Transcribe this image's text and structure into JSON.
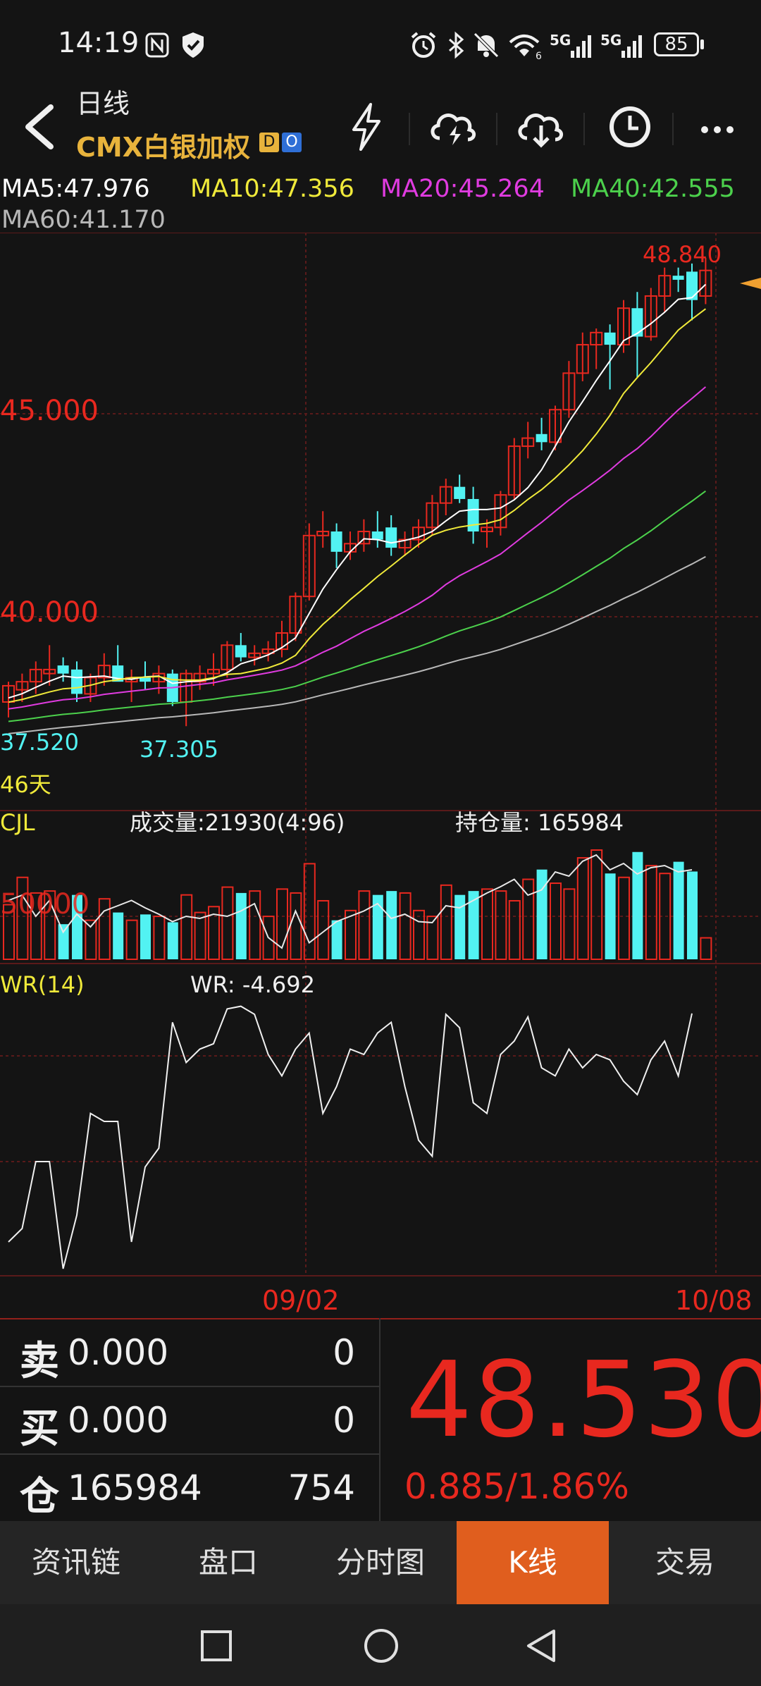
{
  "status_bar": {
    "time": "14:19",
    "icons": [
      "nfc-icon",
      "shield-check-icon",
      "alarm-icon",
      "bluetooth-icon",
      "mute-icon",
      "wifi-6-icon",
      "signal-5g-icon",
      "signal-5g-icon"
    ],
    "battery": "85"
  },
  "header": {
    "title": "日线",
    "subtitle": "CMX白银加权",
    "tag_d": "D",
    "tag_o": "O",
    "buttons": [
      "flash-icon",
      "cloud-upload-icon",
      "cloud-download-icon",
      "clock-icon",
      "more-icon"
    ]
  },
  "ma_legend": {
    "ma5": "MA5:47.976",
    "ma10": "MA10:47.356",
    "ma20": "MA20:45.264",
    "ma40": "MA40:42.555",
    "ma60": "MA60:41.170",
    "colors": {
      "ma5": "#ffffff",
      "ma10": "#f0ea3a",
      "ma20": "#e03be0",
      "ma40": "#4cd14c",
      "ma60": "#b8b8b8"
    }
  },
  "price_axis": {
    "label_45": "45.000",
    "label_40": "40.000",
    "high_label": "48.840",
    "low_label_1": "37.520",
    "low_label_2": "37.305",
    "days": "46天"
  },
  "volume_panel": {
    "name": "CJL",
    "volume": "成交量:21930(4:96)",
    "open_interest": "持仓量: 165984",
    "axis_label": "50000"
  },
  "wr_panel": {
    "name": "WR(14)",
    "value": "WR: -4.692"
  },
  "dates": {
    "start": "09/02",
    "end": "10/08"
  },
  "quote": {
    "sell_label": "卖",
    "sell_price": "0.000",
    "sell_volume": "0",
    "buy_label": "买",
    "buy_price": "0.000",
    "buy_volume": "0",
    "oi_label": "仓",
    "oi_value": "165984",
    "oi_change": "754",
    "last_price": "48.530",
    "change": "0.885/1.86%"
  },
  "tabs": [
    {
      "label": "资讯链",
      "active": false
    },
    {
      "label": "盘口",
      "active": false
    },
    {
      "label": "分时图",
      "active": false
    },
    {
      "label": "K线",
      "active": true
    },
    {
      "label": "交易",
      "active": false
    }
  ],
  "colors": {
    "up": "#e8281f",
    "down": "#52f2f2",
    "accent": "#e05e1e"
  },
  "chart_data": {
    "type": "candlestick",
    "instrument": "CMX白银加权",
    "period": "日线",
    "candles": [
      {
        "o": 37.9,
        "h": 38.4,
        "l": 37.52,
        "c": 38.3
      },
      {
        "o": 38.2,
        "h": 38.6,
        "l": 37.9,
        "c": 38.4
      },
      {
        "o": 38.4,
        "h": 38.9,
        "l": 38.1,
        "c": 38.7
      },
      {
        "o": 38.6,
        "h": 39.3,
        "l": 38.3,
        "c": 38.7
      },
      {
        "o": 38.8,
        "h": 39.0,
        "l": 38.4,
        "c": 38.6
      },
      {
        "o": 38.7,
        "h": 38.9,
        "l": 37.9,
        "c": 38.1
      },
      {
        "o": 38.1,
        "h": 38.6,
        "l": 37.9,
        "c": 38.5
      },
      {
        "o": 38.5,
        "h": 39.1,
        "l": 38.3,
        "c": 38.8
      },
      {
        "o": 38.8,
        "h": 39.3,
        "l": 38.5,
        "c": 38.4
      },
      {
        "o": 38.4,
        "h": 38.7,
        "l": 37.9,
        "c": 38.5
      },
      {
        "o": 38.5,
        "h": 38.9,
        "l": 38.2,
        "c": 38.4
      },
      {
        "o": 38.4,
        "h": 38.8,
        "l": 38.1,
        "c": 38.6
      },
      {
        "o": 38.6,
        "h": 38.7,
        "l": 37.8,
        "c": 37.9
      },
      {
        "o": 37.9,
        "h": 38.7,
        "l": 37.305,
        "c": 38.6
      },
      {
        "o": 38.4,
        "h": 38.8,
        "l": 38.2,
        "c": 38.6
      },
      {
        "o": 38.6,
        "h": 39.1,
        "l": 38.3,
        "c": 38.7
      },
      {
        "o": 38.7,
        "h": 39.4,
        "l": 38.5,
        "c": 39.3
      },
      {
        "o": 39.3,
        "h": 39.6,
        "l": 38.9,
        "c": 39.0
      },
      {
        "o": 39.0,
        "h": 39.3,
        "l": 38.8,
        "c": 39.1
      },
      {
        "o": 39.1,
        "h": 39.4,
        "l": 38.9,
        "c": 39.2
      },
      {
        "o": 39.2,
        "h": 39.9,
        "l": 39.0,
        "c": 39.6
      },
      {
        "o": 39.6,
        "h": 40.6,
        "l": 39.4,
        "c": 40.5
      },
      {
        "o": 40.5,
        "h": 42.3,
        "l": 40.4,
        "c": 42.0
      },
      {
        "o": 42.0,
        "h": 42.6,
        "l": 41.7,
        "c": 42.1
      },
      {
        "o": 42.1,
        "h": 42.3,
        "l": 41.2,
        "c": 41.6
      },
      {
        "o": 41.6,
        "h": 42.1,
        "l": 41.4,
        "c": 41.8
      },
      {
        "o": 41.8,
        "h": 42.4,
        "l": 41.6,
        "c": 42.1
      },
      {
        "o": 42.1,
        "h": 42.6,
        "l": 41.7,
        "c": 41.9
      },
      {
        "o": 42.2,
        "h": 42.5,
        "l": 41.5,
        "c": 41.7
      },
      {
        "o": 41.7,
        "h": 42.1,
        "l": 41.5,
        "c": 41.9
      },
      {
        "o": 41.9,
        "h": 42.4,
        "l": 41.7,
        "c": 42.2
      },
      {
        "o": 42.2,
        "h": 43.0,
        "l": 42.0,
        "c": 42.8
      },
      {
        "o": 42.8,
        "h": 43.4,
        "l": 42.5,
        "c": 43.2
      },
      {
        "o": 43.2,
        "h": 43.5,
        "l": 42.8,
        "c": 42.9
      },
      {
        "o": 42.9,
        "h": 43.2,
        "l": 41.8,
        "c": 42.1
      },
      {
        "o": 42.1,
        "h": 42.4,
        "l": 41.7,
        "c": 42.2
      },
      {
        "o": 42.2,
        "h": 43.1,
        "l": 42.0,
        "c": 43.0
      },
      {
        "o": 43.0,
        "h": 44.4,
        "l": 42.9,
        "c": 44.2
      },
      {
        "o": 44.2,
        "h": 44.8,
        "l": 43.9,
        "c": 44.4
      },
      {
        "o": 44.5,
        "h": 44.9,
        "l": 44.1,
        "c": 44.3
      },
      {
        "o": 44.3,
        "h": 45.2,
        "l": 44.1,
        "c": 45.1
      },
      {
        "o": 45.1,
        "h": 46.3,
        "l": 44.9,
        "c": 46.0
      },
      {
        "o": 46.0,
        "h": 47.0,
        "l": 45.8,
        "c": 46.7
      },
      {
        "o": 46.7,
        "h": 47.1,
        "l": 46.1,
        "c": 47.0
      },
      {
        "o": 47.0,
        "h": 47.2,
        "l": 45.6,
        "c": 46.7
      },
      {
        "o": 46.7,
        "h": 47.8,
        "l": 46.5,
        "c": 47.6
      },
      {
        "o": 47.6,
        "h": 48.0,
        "l": 45.9,
        "c": 46.9
      },
      {
        "o": 46.9,
        "h": 48.1,
        "l": 46.8,
        "c": 47.9
      },
      {
        "o": 47.9,
        "h": 48.6,
        "l": 47.5,
        "c": 48.4
      },
      {
        "o": 48.4,
        "h": 48.6,
        "l": 48.0,
        "c": 48.3
      },
      {
        "o": 48.5,
        "h": 48.7,
        "l": 47.3,
        "c": 47.8
      },
      {
        "o": 47.9,
        "h": 48.84,
        "l": 47.7,
        "c": 48.53
      }
    ],
    "volume": [
      28000,
      42000,
      34000,
      35000,
      18000,
      33000,
      20000,
      31000,
      24000,
      20000,
      23000,
      22000,
      19000,
      33000,
      24000,
      27000,
      37000,
      34000,
      35000,
      22000,
      36000,
      34000,
      49000,
      30000,
      20000,
      25000,
      35000,
      33000,
      35000,
      34000,
      25000,
      22000,
      38000,
      33000,
      35000,
      36000,
      35000,
      30000,
      41000,
      46000,
      39000,
      36000,
      52000,
      56000,
      44000,
      42000,
      55000,
      48000,
      44000,
      50000,
      45000,
      11000
    ],
    "open_interest_line": [
      0.55,
      0.6,
      0.4,
      0.55,
      0.25,
      0.42,
      0.3,
      0.45,
      0.5,
      0.55,
      0.48,
      0.42,
      0.35,
      0.4,
      0.38,
      0.42,
      0.4,
      0.45,
      0.52,
      0.2,
      0.1,
      0.45,
      0.15,
      0.25,
      0.35,
      0.4,
      0.45,
      0.52,
      0.38,
      0.42,
      0.35,
      0.34,
      0.5,
      0.48,
      0.55,
      0.62,
      0.68,
      0.75,
      0.6,
      0.65,
      0.82,
      0.78,
      0.92,
      0.98,
      0.84,
      0.9,
      0.8,
      0.86,
      0.88,
      0.82,
      0.84
    ],
    "wr": [
      -90,
      -85,
      -60,
      -60,
      -100,
      -80,
      -42,
      -45,
      -45,
      -90,
      -62,
      -55,
      -8,
      -23,
      -18,
      -16,
      -3,
      -2,
      -5,
      -20,
      -28,
      -18,
      -12,
      -42,
      -32,
      -18,
      -20,
      -12,
      -8,
      -32,
      -52,
      -58,
      -5,
      -10,
      -38,
      -42,
      -20,
      -15,
      -6,
      -25,
      -28,
      -18,
      -25,
      -20,
      -22,
      -30,
      -35,
      -22,
      -15,
      -28,
      -4.692
    ]
  }
}
